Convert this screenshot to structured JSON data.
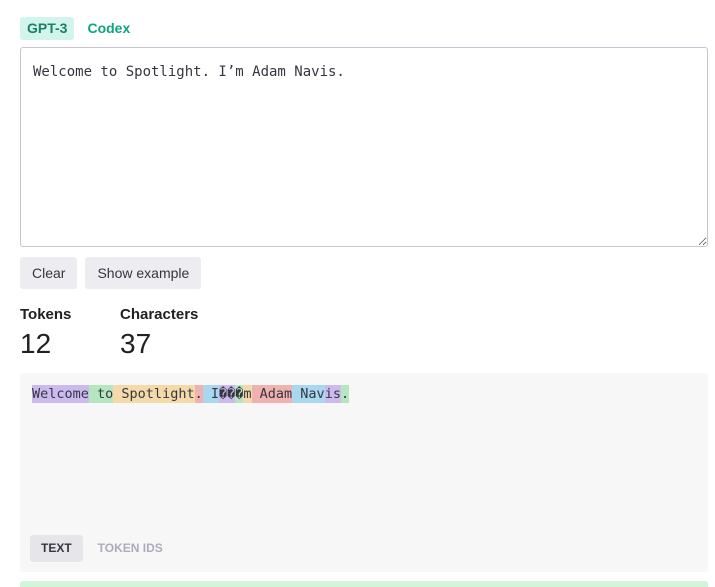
{
  "tabs": [
    {
      "label": "GPT-3",
      "active": true
    },
    {
      "label": "Codex",
      "active": false
    }
  ],
  "input": {
    "value": "Welcome to Spotlight. I’m Adam Navis."
  },
  "buttons": {
    "clear_label": "Clear",
    "example_label": "Show example"
  },
  "stats": {
    "tokens_label": "Tokens",
    "tokens_value": "12",
    "characters_label": "Characters",
    "characters_value": "37"
  },
  "tokens": [
    {
      "text": "Welcome",
      "color": "#cbb9ef"
    },
    {
      "text": " to",
      "color": "#b6e6bf"
    },
    {
      "text": " Spotlight",
      "color": "#f6d9a8"
    },
    {
      "text": ".",
      "color": "#f0b1b1"
    },
    {
      "text": " I",
      "color": "#a8d8f0"
    },
    {
      "text": "��",
      "color": "#cbb9ef"
    },
    {
      "text": "�",
      "color": "#b6e6bf"
    },
    {
      "text": "m",
      "color": "#f6d9a8"
    },
    {
      "text": " Adam",
      "color": "#f0b1b1"
    },
    {
      "text": " Nav",
      "color": "#a8d8f0"
    },
    {
      "text": "is",
      "color": "#cbb9ef"
    },
    {
      "text": ".",
      "color": "#b6e6bf"
    }
  ],
  "view_toggle": {
    "text_label": "TEXT",
    "ids_label": "TOKEN IDS"
  }
}
